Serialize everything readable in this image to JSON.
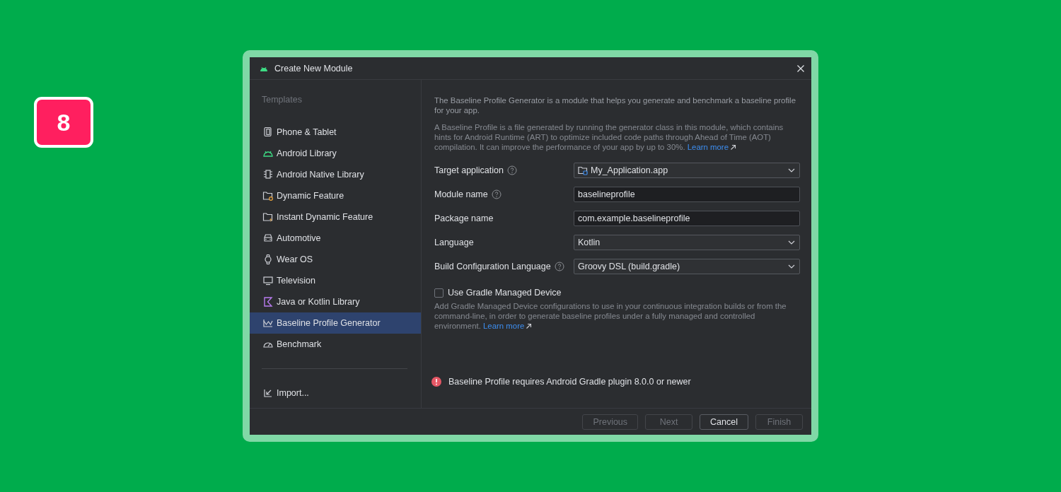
{
  "badge": "8",
  "window": {
    "title": "Create New Module"
  },
  "sidebar": {
    "heading": "Templates",
    "items": [
      {
        "label": "Phone & Tablet",
        "selected": false
      },
      {
        "label": "Android Library",
        "selected": false
      },
      {
        "label": "Android Native Library",
        "selected": false
      },
      {
        "label": "Dynamic Feature",
        "selected": false
      },
      {
        "label": "Instant Dynamic Feature",
        "selected": false
      },
      {
        "label": "Automotive",
        "selected": false
      },
      {
        "label": "Wear OS",
        "selected": false
      },
      {
        "label": "Television",
        "selected": false
      },
      {
        "label": "Java or Kotlin Library",
        "selected": false
      },
      {
        "label": "Baseline Profile Generator",
        "selected": true
      },
      {
        "label": "Benchmark",
        "selected": false
      }
    ],
    "import": "Import..."
  },
  "intro": [
    {
      "text": "The Baseline Profile Generator is a module that helps you generate and benchmark a baseline profile for your app."
    },
    {
      "text": "A Baseline Profile is a file generated by running the generator class in this module, which contains hints for Android Runtime (ART) to optimize included code paths through Ahead of Time (AOT) compilation. It can improve the performance of your app by up to 30%.",
      "link": "Learn more"
    }
  ],
  "fields": [
    {
      "label": "Target application",
      "help": true,
      "kind": "moduleselect",
      "value": "My_Application.app"
    },
    {
      "label": "Module name",
      "help": true,
      "kind": "text",
      "value": "baselineprofile"
    },
    {
      "label": "Package name",
      "help": false,
      "kind": "text",
      "value": "com.example.baselineprofile"
    },
    {
      "label": "Language",
      "help": false,
      "kind": "dropdown",
      "value": "Kotlin"
    },
    {
      "label": "Build Configuration Language",
      "help": true,
      "kind": "dropdown",
      "value": "Groovy DSL (build.gradle)"
    }
  ],
  "gradle_device": {
    "label": "Use Gradle Managed Device",
    "checked": false,
    "description": "Add Gradle Managed Device configurations to use in your continuous integration builds or from the command-line, in order to generate baseline profiles under a fully managed and controlled environment.",
    "link": "Learn more"
  },
  "error": "Baseline Profile requires Android Gradle plugin 8.0.0 or newer",
  "buttons": [
    {
      "label": "Previous",
      "disabled": true
    },
    {
      "label": "Next",
      "disabled": true
    },
    {
      "label": "Cancel",
      "disabled": false
    },
    {
      "label": "Finish",
      "disabled": true
    }
  ]
}
